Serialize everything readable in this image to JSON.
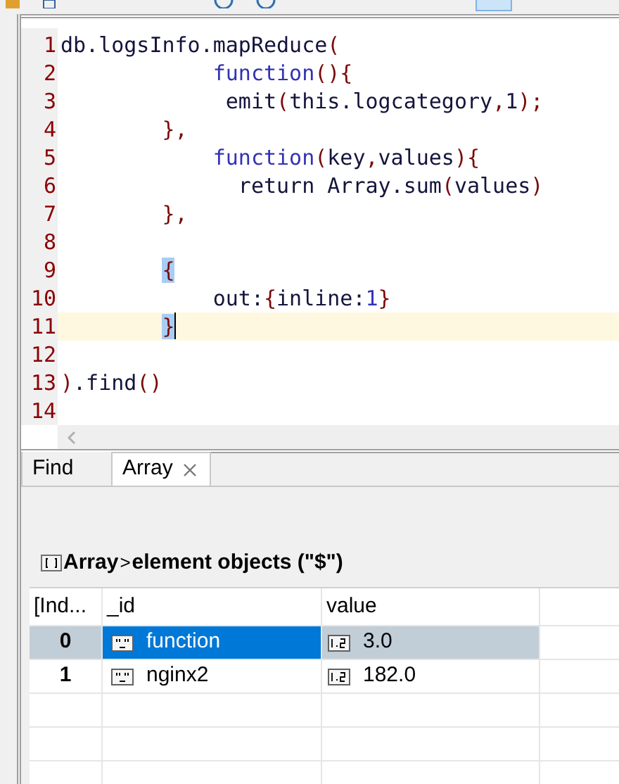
{
  "editor": {
    "lines": [
      {
        "number": "1",
        "current": false,
        "tokens": [
          {
            "text": "db.logsInfo.mapReduce",
            "kind": "text"
          },
          {
            "text": "(",
            "kind": "punct"
          }
        ]
      },
      {
        "number": "2",
        "current": false,
        "tokens": [
          {
            "text": "            function",
            "kind": "keyword"
          },
          {
            "text": "(){",
            "kind": "punct"
          }
        ]
      },
      {
        "number": "3",
        "current": false,
        "tokens": [
          {
            "text": "             emit",
            "kind": "text"
          },
          {
            "text": "(",
            "kind": "punct"
          },
          {
            "text": "this.logcategory",
            "kind": "text"
          },
          {
            "text": ",",
            "kind": "punct"
          },
          {
            "text": "1",
            "kind": "text"
          },
          {
            "text": ");",
            "kind": "punct"
          }
        ]
      },
      {
        "number": "4",
        "current": false,
        "tokens": [
          {
            "text": "        },",
            "kind": "punct"
          }
        ]
      },
      {
        "number": "5",
        "current": false,
        "tokens": [
          {
            "text": "            function",
            "kind": "keyword"
          },
          {
            "text": "(",
            "kind": "punct"
          },
          {
            "text": "key",
            "kind": "text"
          },
          {
            "text": ",",
            "kind": "punct"
          },
          {
            "text": "values",
            "kind": "text"
          },
          {
            "text": "){",
            "kind": "punct"
          }
        ]
      },
      {
        "number": "6",
        "current": false,
        "tokens": [
          {
            "text": "              return Array.sum",
            "kind": "text"
          },
          {
            "text": "(",
            "kind": "punct"
          },
          {
            "text": "values",
            "kind": "text"
          },
          {
            "text": ")",
            "kind": "punct"
          }
        ]
      },
      {
        "number": "7",
        "current": false,
        "tokens": [
          {
            "text": "        },",
            "kind": "punct"
          }
        ]
      },
      {
        "number": "8",
        "current": false
      },
      {
        "number": "9",
        "current": false,
        "tokens": [
          {
            "text": "        {",
            "kind": "match"
          }
        ]
      },
      {
        "number": "10",
        "current": false,
        "tokens": [
          {
            "text": "            out:",
            "kind": "text"
          },
          {
            "text": "{",
            "kind": "punct"
          },
          {
            "text": "inline:",
            "kind": "text"
          },
          {
            "text": "1",
            "kind": "number"
          },
          {
            "text": "}",
            "kind": "punct"
          }
        ]
      },
      {
        "number": "11",
        "current": true,
        "tokens": [
          {
            "text": "        }",
            "kind": "match"
          }
        ]
      },
      {
        "number": "12",
        "current": false
      },
      {
        "number": "13",
        "current": false,
        "tokens": [
          {
            "text": ")",
            "kind": "punct"
          },
          {
            "text": ".find",
            "kind": "text"
          },
          {
            "text": "()",
            "kind": "punct"
          }
        ]
      },
      {
        "number": "14",
        "current": false
      }
    ]
  },
  "tabs": [
    {
      "label": "Find",
      "selected": false,
      "closable": false
    },
    {
      "label": "Array",
      "selected": true,
      "closable": true
    }
  ],
  "breadcrumb": {
    "root": "Array",
    "separator": ">",
    "current": "element objects (\"$\")"
  },
  "table": {
    "columns": [
      "[Ind...",
      "_id",
      "value"
    ],
    "rows": [
      {
        "index": "0",
        "id": "function",
        "value": "3.0",
        "selected": true
      },
      {
        "index": "1",
        "id": "nginx2",
        "value": "182.0",
        "selected": false
      }
    ]
  }
}
